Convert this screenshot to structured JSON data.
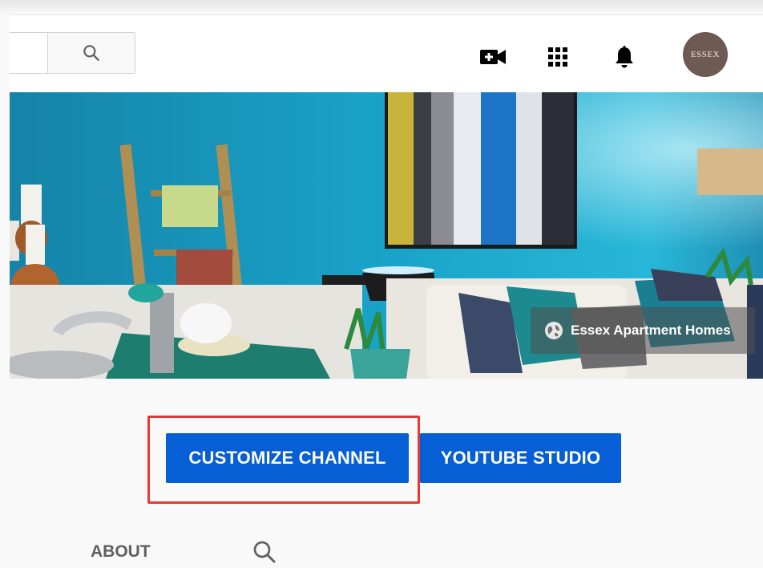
{
  "header": {
    "search_icon": "search-icon",
    "create_icon": "video-camera-plus-icon",
    "apps_icon": "apps-grid-icon",
    "notifications_icon": "bell-icon",
    "avatar_text": "ESSEX"
  },
  "banner": {
    "link_label": "Essex Apartment Homes",
    "link_icon": "globe-icon"
  },
  "actions": {
    "customize_label": "CUSTOMIZE CHANNEL",
    "studio_label": "YOUTUBE STUDIO",
    "button_color": "#065fd4",
    "highlight_color": "#e53935"
  },
  "tabs": {
    "about_label": "ABOUT",
    "search_icon": "search-icon"
  }
}
